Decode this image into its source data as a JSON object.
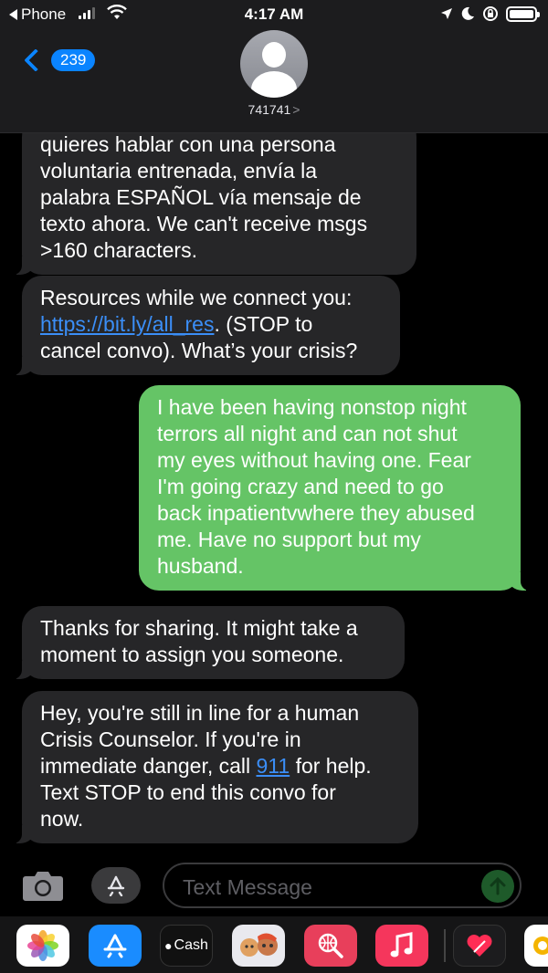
{
  "status_bar": {
    "back_app": "Phone",
    "time": "4:17 AM"
  },
  "header": {
    "unread_count": "239",
    "contact": "741741",
    "contact_chevron": ">"
  },
  "messages": [
    {
      "direction": "incoming",
      "text": "quieres hablar con una persona\nvoluntaria entrenada, envía la\npalabra ESPAÑOL vía mensaje de\ntexto ahora. We can't receive msgs\n>160 characters."
    },
    {
      "direction": "incoming",
      "text_before": "Resources while we connect you:\n",
      "link": "https://bit.ly/all_res",
      "text_after": ". (STOP to\ncancel convo). What’s your crisis?"
    },
    {
      "direction": "outgoing",
      "text": "I have been having nonstop night\nterrors all night and can not shut\nmy eyes without having one. Fear\nI'm going crazy and need to go\nback inpatientvwhere they abused\nme. Have no support but my\nhusband."
    },
    {
      "direction": "incoming",
      "text": "Thanks for sharing. It might take a\nmoment to assign you someone."
    },
    {
      "direction": "incoming",
      "text_before": "Hey, you're still in line for a human\nCrisis Counselor. If you're in\nimmediate danger, call ",
      "link": "911",
      "text_after": " for help.\nText STOP to end this convo for\nnow."
    }
  ],
  "composer": {
    "placeholder": "Text Message"
  },
  "app_drawer": {
    "cash_label": "Cash",
    "apps": [
      "photos-app",
      "app-store-app",
      "apple-cash-app",
      "memoji-app",
      "web-search-app",
      "music-app",
      "digital-touch-app",
      "partial-app"
    ]
  },
  "colors": {
    "outgoing_bubble": "#65c466",
    "incoming_bubble": "#262628",
    "accent": "#0a84ff"
  }
}
